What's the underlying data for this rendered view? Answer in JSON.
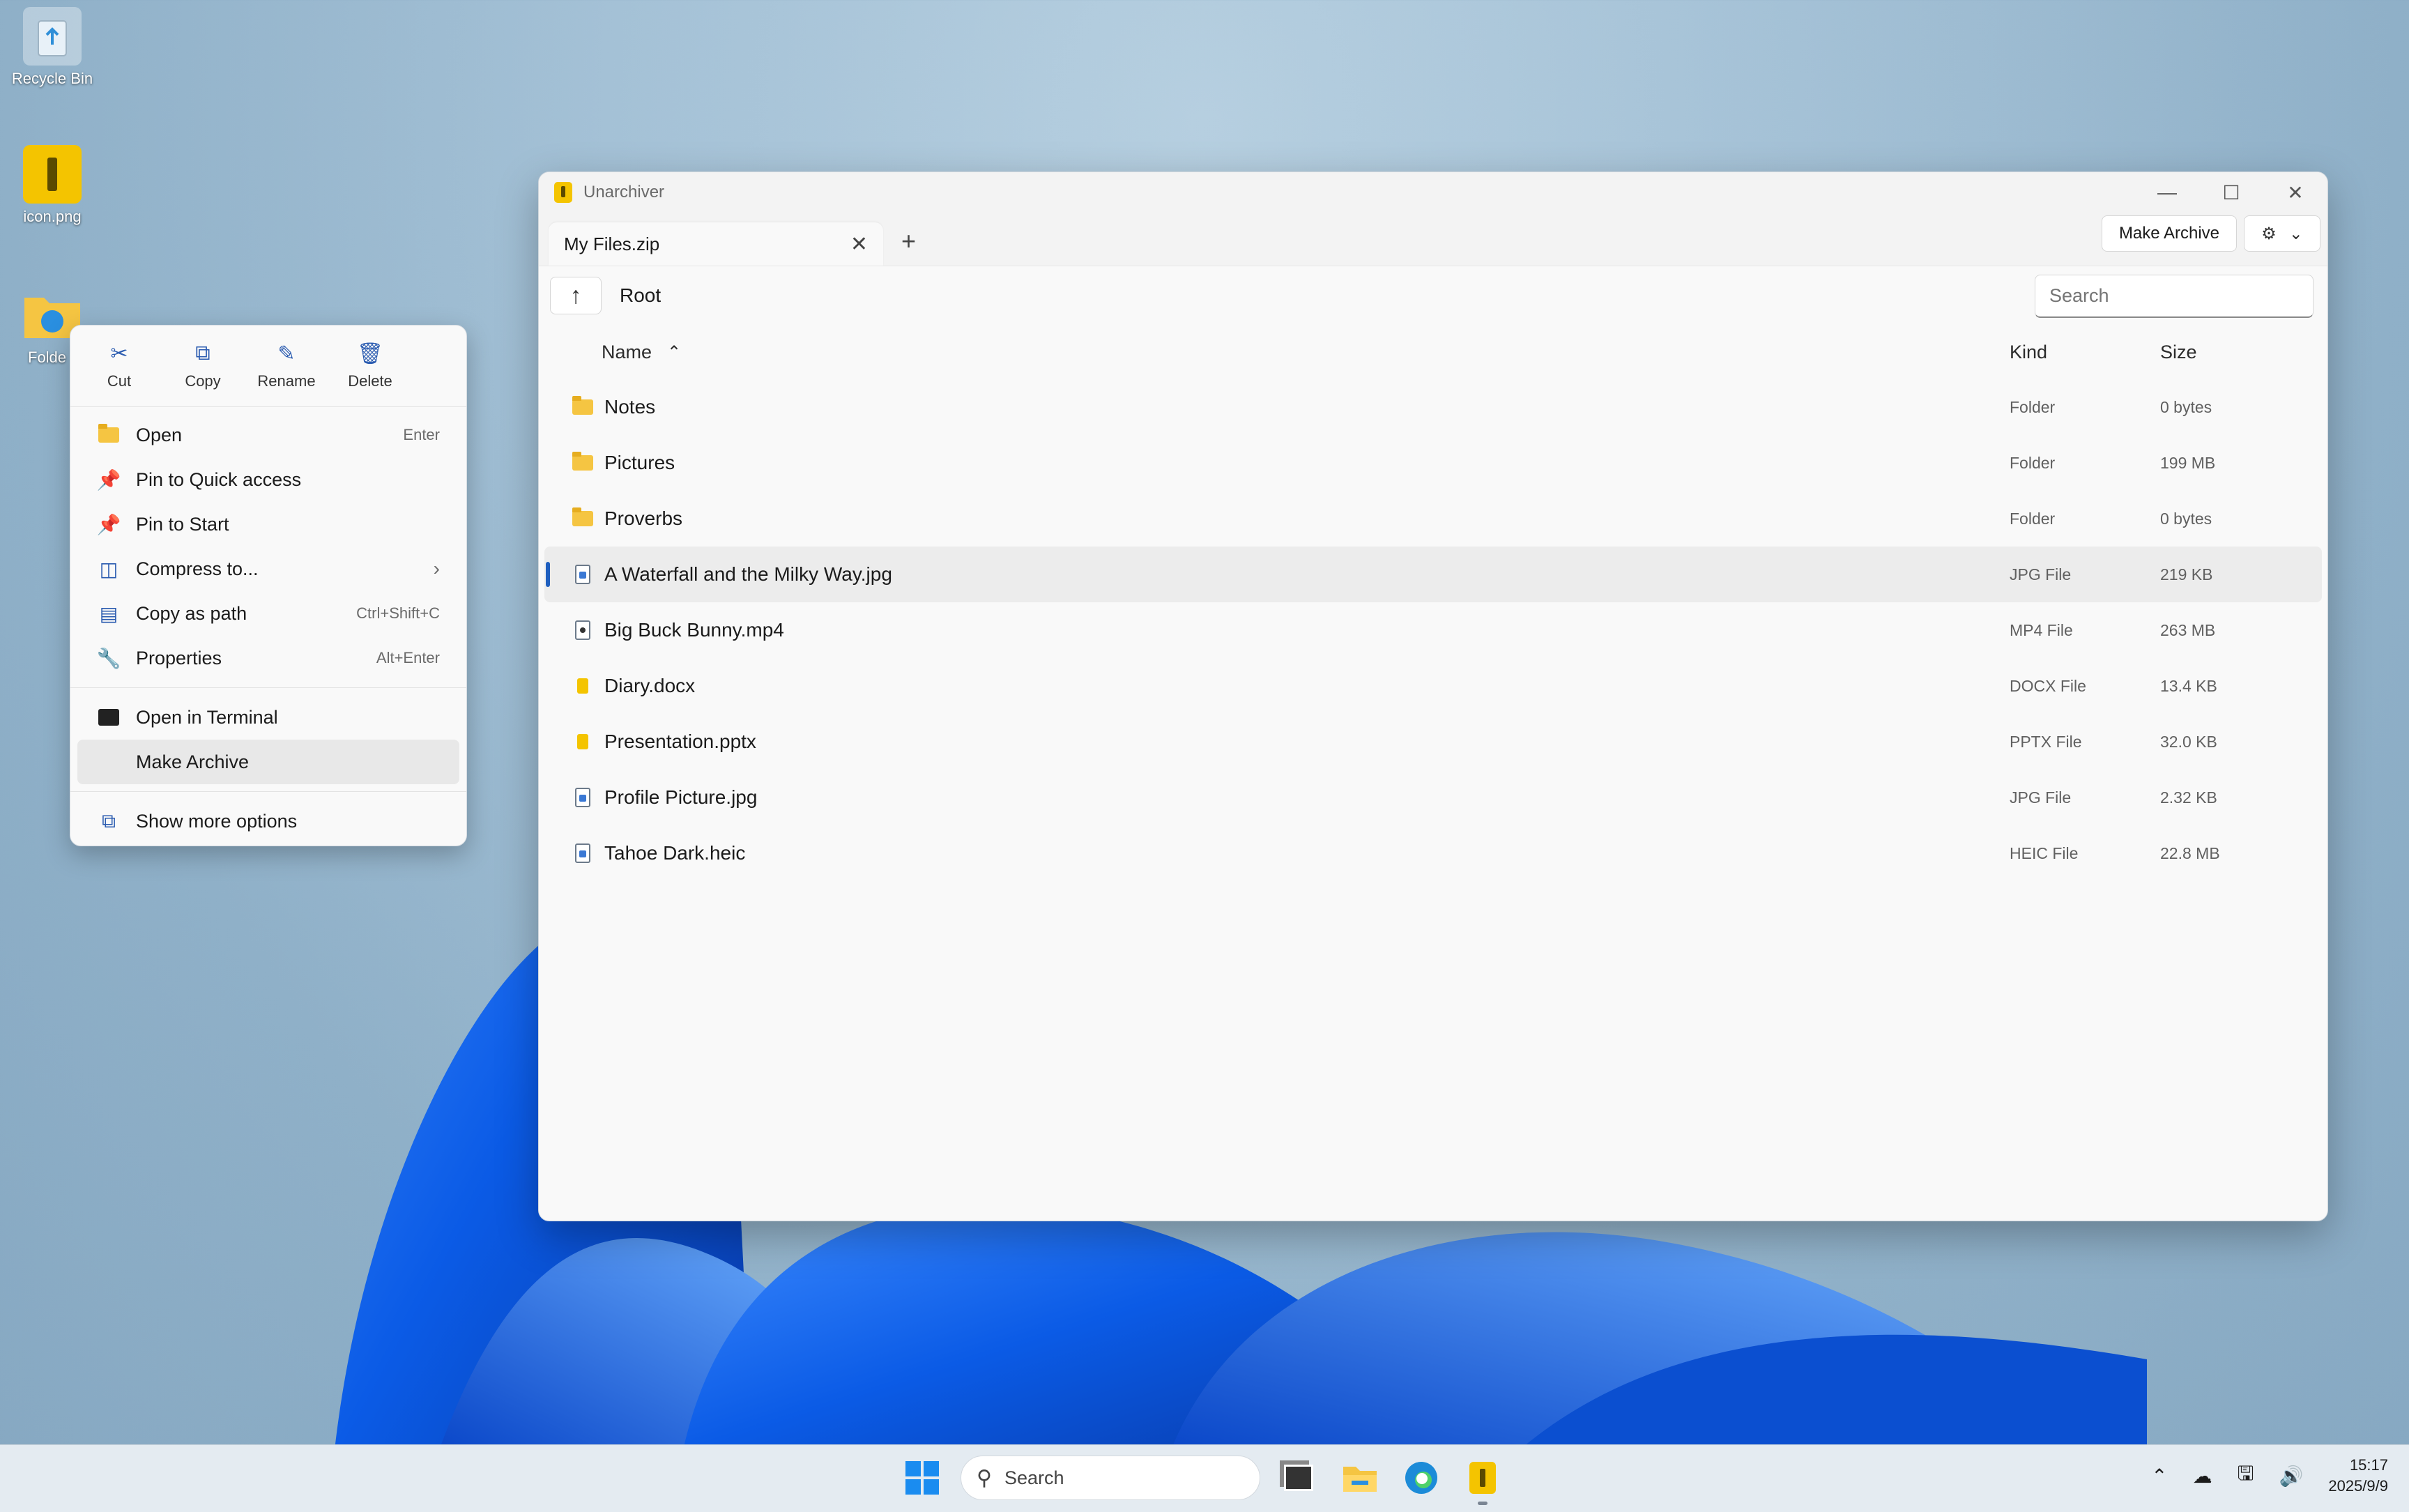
{
  "desktop": {
    "icons": [
      {
        "label": "Recycle Bin"
      },
      {
        "label": "icon.png"
      },
      {
        "label": "Folde"
      }
    ]
  },
  "window": {
    "title": "Unarchiver",
    "tab": {
      "title": "My Files.zip"
    },
    "make_archive_label": "Make Archive",
    "path": "Root",
    "search_placeholder": "Search",
    "columns": {
      "name": "Name",
      "kind": "Kind",
      "size": "Size"
    },
    "rows": [
      {
        "name": "Notes",
        "kind": "Folder",
        "size": "0 bytes",
        "icon": "folder-icon"
      },
      {
        "name": "Pictures",
        "kind": "Folder",
        "size": "199 MB",
        "icon": "folder-icon"
      },
      {
        "name": "Proverbs",
        "kind": "Folder",
        "size": "0 bytes",
        "icon": "folder-icon"
      },
      {
        "name": "A Waterfall and the Milky Way.jpg",
        "kind": "JPG File",
        "size": "219 KB",
        "icon": "image-file-icon",
        "selected": true
      },
      {
        "name": "Big Buck Bunny.mp4",
        "kind": "MP4 File",
        "size": "263 MB",
        "icon": "video-file-icon"
      },
      {
        "name": "Diary.docx",
        "kind": "DOCX File",
        "size": "13.4 KB",
        "icon": "archive-file-icon"
      },
      {
        "name": "Presentation.pptx",
        "kind": "PPTX File",
        "size": "32.0 KB",
        "icon": "archive-file-icon"
      },
      {
        "name": "Profile Picture.jpg",
        "kind": "JPG File",
        "size": "2.32 KB",
        "icon": "image-file-icon"
      },
      {
        "name": "Tahoe Dark.heic",
        "kind": "HEIC File",
        "size": "22.8 MB",
        "icon": "image-file-icon"
      }
    ]
  },
  "context_menu": {
    "actions": [
      {
        "label": "Cut",
        "icon": "scissors-icon"
      },
      {
        "label": "Copy",
        "icon": "copy-icon"
      },
      {
        "label": "Rename",
        "icon": "rename-icon"
      },
      {
        "label": "Delete",
        "icon": "trash-icon"
      }
    ],
    "items": [
      {
        "label": "Open",
        "shortcut": "Enter",
        "icon": "folder-open-icon"
      },
      {
        "label": "Pin to Quick access",
        "shortcut": "",
        "icon": "pin-icon"
      },
      {
        "label": "Pin to Start",
        "shortcut": "",
        "icon": "pin-icon"
      },
      {
        "label": "Compress to...",
        "shortcut": "",
        "icon": "compress-icon",
        "submenu": true
      },
      {
        "label": "Copy as path",
        "shortcut": "Ctrl+Shift+C",
        "icon": "path-icon"
      },
      {
        "label": "Properties",
        "shortcut": "Alt+Enter",
        "icon": "wrench-icon"
      }
    ],
    "items2": [
      {
        "label": "Open in Terminal",
        "icon": "terminal-icon"
      },
      {
        "label": "Make Archive",
        "icon": "",
        "highlighted": true
      }
    ],
    "more": {
      "label": "Show more options",
      "icon": "more-options-icon"
    }
  },
  "taskbar": {
    "search_label": "Search",
    "time": "15:17",
    "date": "2025/9/9"
  },
  "colors": {
    "accent": "#1f5fbf",
    "app_yellow": "#f4c400"
  }
}
